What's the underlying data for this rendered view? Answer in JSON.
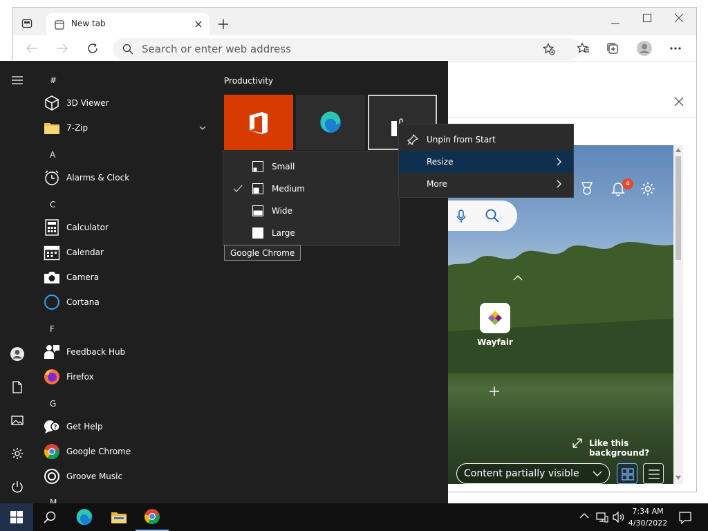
{
  "browser": {
    "tab_title": "New tab",
    "address_placeholder": "Search or enter web address"
  },
  "ntp": {
    "notification_count": "4",
    "quick_link_label": "Wayfair",
    "like_background": "Like this background?",
    "content_dropdown": "Content partially visible"
  },
  "start": {
    "group_title": "Productivity",
    "letters": {
      "hash": "#",
      "a": "A",
      "c": "C",
      "f": "F",
      "g": "G",
      "m": "M"
    },
    "apps": {
      "viewer3d": "3D Viewer",
      "zip7": "7-Zip",
      "alarms": "Alarms & Clock",
      "calculator": "Calculator",
      "calendar": "Calendar",
      "camera": "Camera",
      "cortana": "Cortana",
      "feedback": "Feedback Hub",
      "firefox": "Firefox",
      "gethelp": "Get Help",
      "chrome": "Google Chrome",
      "groove": "Groove Music"
    }
  },
  "context_menu": {
    "unpin": "Unpin from Start",
    "resize": "Resize",
    "more": "More"
  },
  "resize_menu": {
    "small": "Small",
    "medium": "Medium",
    "wide": "Wide",
    "large": "Large"
  },
  "tooltip": "Google Chrome",
  "taskbar": {
    "time": "7:34 AM",
    "date": "4/30/2022"
  },
  "colors": {
    "office_tile": "#d83b01",
    "menu_highlight": "#0f2f4f",
    "badge": "#e8462f"
  }
}
